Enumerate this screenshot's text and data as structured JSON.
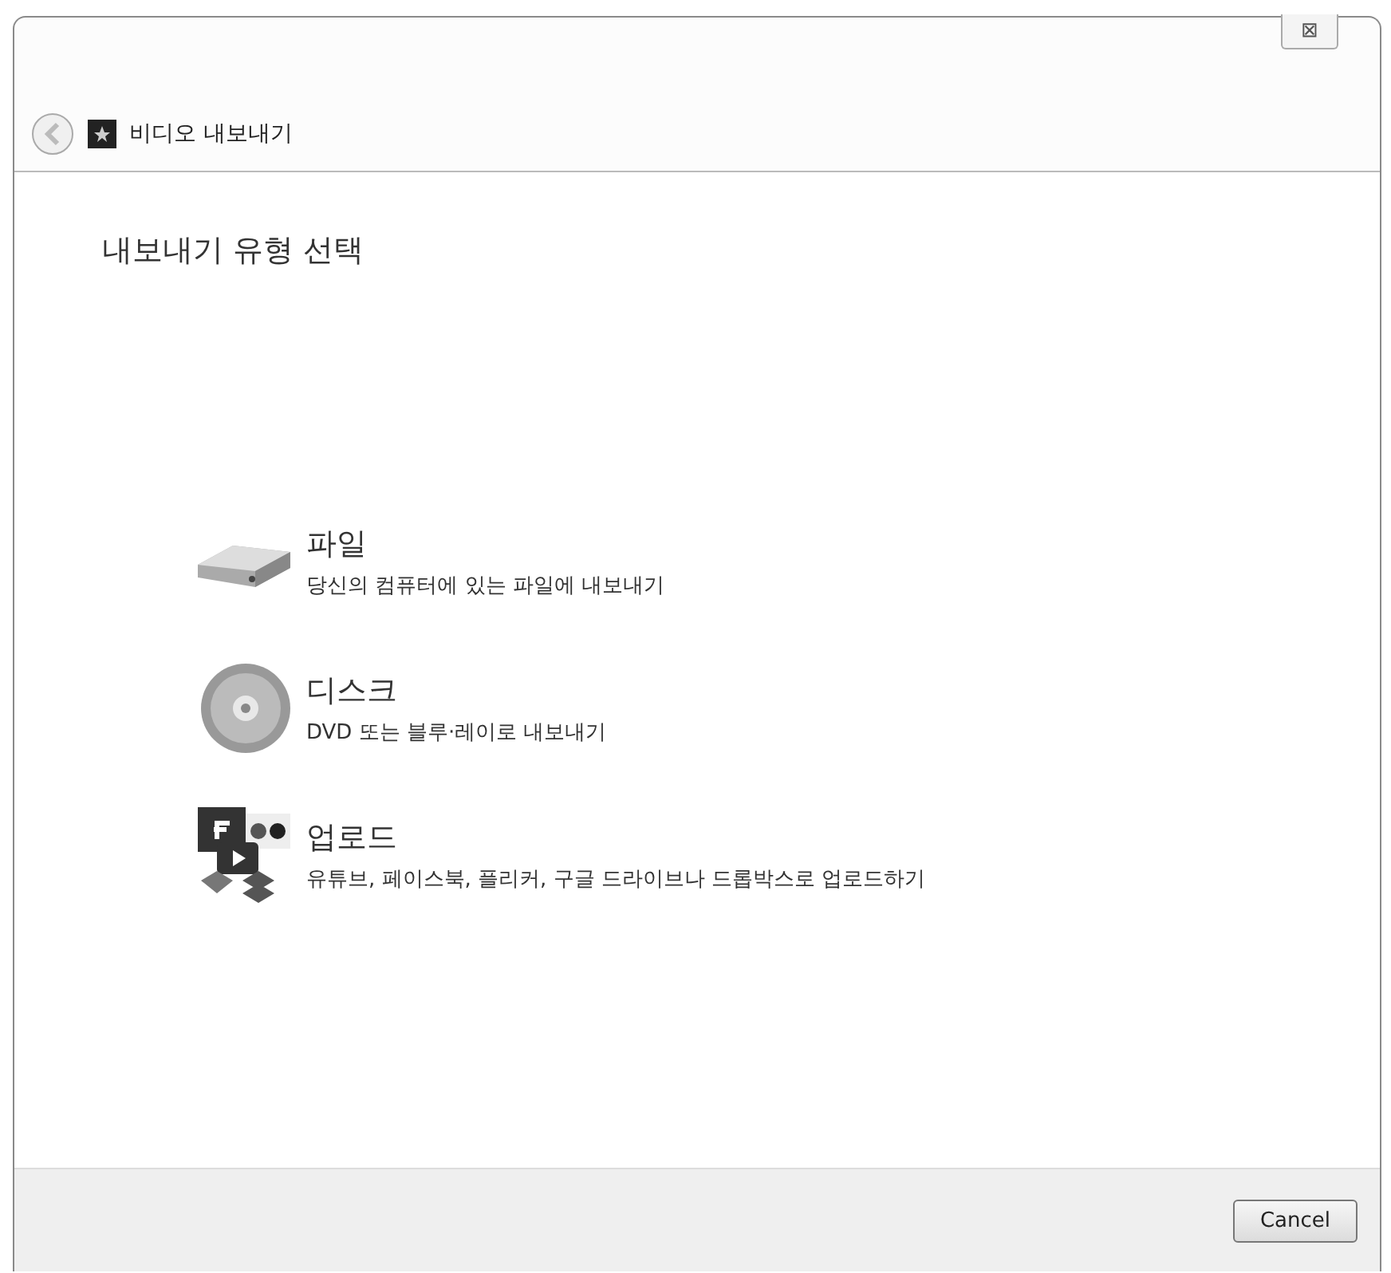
{
  "window": {
    "close": "⊠",
    "title": "비디오 내보내기"
  },
  "heading": "내보내기 유형 선택",
  "options": [
    {
      "kind": "file",
      "title": "파일",
      "description": "당신의 컴퓨터에 있는 파일에 내보내기"
    },
    {
      "kind": "disc",
      "title": "디스크",
      "description": "DVD 또는 블루·레이로 내보내기"
    },
    {
      "kind": "upload",
      "title": "업로드",
      "description": "유튜브, 페이스북, 플리커, 구글 드라이브나 드롭박스로 업로드하기"
    }
  ],
  "buttons": [
    "Cancel"
  ]
}
